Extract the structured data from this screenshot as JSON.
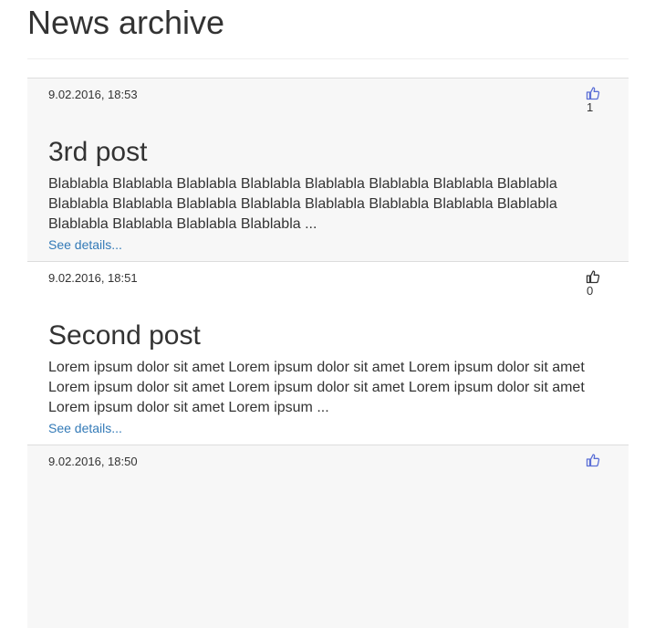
{
  "page": {
    "title": "News archive"
  },
  "posts": [
    {
      "date": "9.02.2016, 18:53",
      "likes": "1",
      "liked": true,
      "title": "3rd post",
      "excerpt": "Blablabla Blablabla Blablabla Blablabla Blablabla Blablabla Blablabla Blablabla Blablabla Blablabla Blablabla Blablabla Blablabla Blablabla Blablabla Blablabla Blablabla Blablabla Blablabla Blablabla ...",
      "details_label": "See details..."
    },
    {
      "date": "9.02.2016, 18:51",
      "likes": "0",
      "liked": false,
      "title": "Second post",
      "excerpt": "Lorem ipsum dolor sit amet Lorem ipsum dolor sit amet Lorem ipsum dolor sit amet Lorem ipsum dolor sit amet Lorem ipsum dolor sit amet Lorem ipsum dolor sit amet Lorem ipsum dolor sit amet Lorem ipsum ...",
      "details_label": "See details..."
    },
    {
      "date": "9.02.2016, 18:50",
      "liked": true
    }
  ],
  "colors": {
    "liked_icon": "#5b6fd6",
    "unliked_icon": "#333333",
    "link": "#337ab7"
  },
  "icons": {
    "like": "thumbs-up-icon"
  }
}
